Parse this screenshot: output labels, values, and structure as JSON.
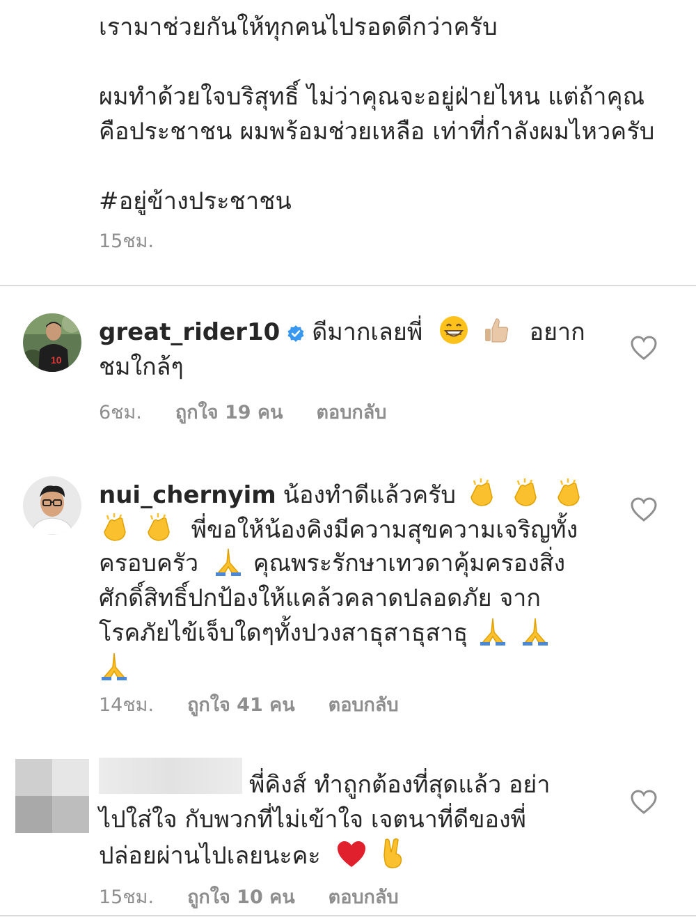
{
  "caption": {
    "lines": [
      "เรามาช่วยกันให้ทุกคนไปรอดดีกว่าครับ",
      "",
      "ผมทำด้วยใจบริสุทธิ์ ไม่ว่าคุณจะอยู่ฝ่ายไหน แต่ถ้าคุณ",
      "คือประชาชน ผมพร้อมช่วยเหลือ เท่าที่กำลังผมไหวครับ",
      "",
      "#อยู่ข้างประชาชน"
    ],
    "time": "15ชม."
  },
  "comments": [
    {
      "username": "great_rider10",
      "verified": true,
      "line1_text": "ดีมากเลยพี่",
      "line1_emojis": [
        "grinning-face-emoji",
        "thumbs-up-emoji"
      ],
      "line1_tail": "อยาก",
      "line2": "ชมใกล้ๆ",
      "time": "6ชม.",
      "likes": "ถูกใจ 19 คน",
      "reply": "ตอบกลับ"
    },
    {
      "username": "nui_chernyim",
      "verified": false,
      "line1_text": "น้องทำดีแล้วครับ",
      "line2_text": "พี่ขอให้น้องคิงมีความสุขความเจริญทั้ง",
      "line3_a": "ครอบครัว",
      "line3_b": "คุณพระรักษาเทวดาคุ้มครองสิ่ง",
      "line4": "ศักดิ์สิทธิ์ปกป้องให้แคล้วคลาดปลอดภัย จาก",
      "line5": "โรคภัยไข้เจ็บใดๆทั้งปวงสาธุสาธุสาธุ",
      "time": "14ชม.",
      "likes": "ถูกใจ 41 คน",
      "reply": "ตอบกลับ"
    },
    {
      "username_hidden": true,
      "line1": "พี่คิงส์ ทำถูกต้องที่สุดแล้ว อย่า",
      "line2": "ไปใส่ใจ กับพวกที่ไม่เข้าใจ เจตนาที่ดีของพี่",
      "line3": "ปล่อยผ่านไปเลยนะคะ",
      "line3_emojis": [
        "red-heart-emoji",
        "victory-hand-emoji"
      ],
      "time": "15ชม.",
      "likes": "ถูกใจ 10 คน",
      "reply": "ตอบกลับ"
    }
  ],
  "colors": {
    "text": "#262626",
    "meta": "#8e8e8e",
    "divider": "#dbdbdb",
    "verified": "#3897f0"
  }
}
